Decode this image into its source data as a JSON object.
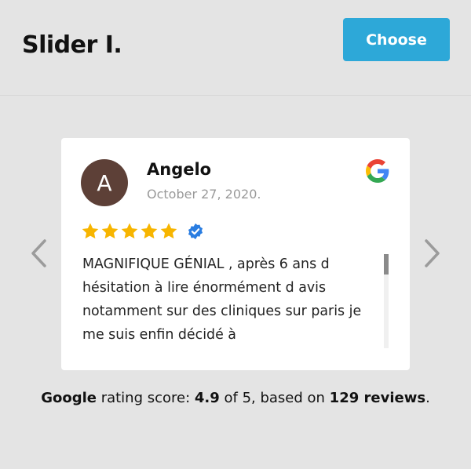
{
  "header": {
    "title": "Slider I.",
    "choose_label": "Choose"
  },
  "review": {
    "avatar_letter": "A",
    "author": "Angelo",
    "date": "October 27, 2020.",
    "rating": 5,
    "text": "MAGNIFIQUE GÉNIAL , après 6 ans d hésitation à lire énormément d avis notamment sur des cliniques sur paris je me suis enfin décidé à",
    "source_icon": "google-icon",
    "verified_icon": "verified-badge-icon"
  },
  "summary": {
    "brand": "Google",
    "label": " rating score: ",
    "score": "4.9",
    "of_text": " of 5, based on ",
    "reviews": "129 reviews",
    "end": "."
  },
  "colors": {
    "accent": "#2da8d8",
    "star": "#f7b500",
    "avatar": "#5d4037",
    "verified": "#2a7de1"
  }
}
